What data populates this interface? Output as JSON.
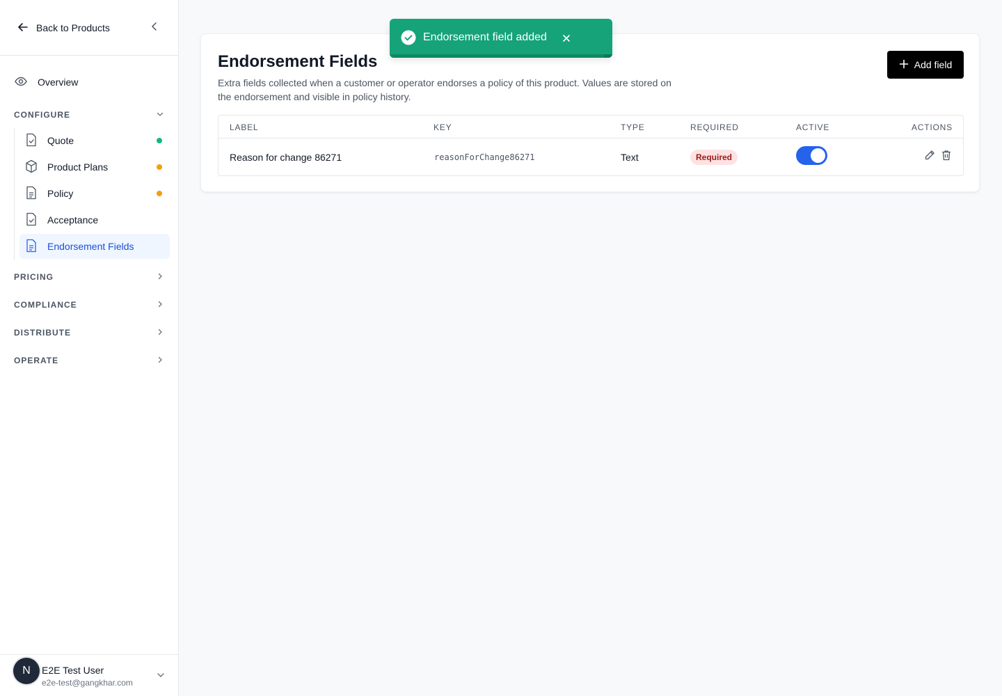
{
  "sidebar": {
    "back_label": "Back to Products",
    "overview_label": "Overview",
    "configure": {
      "heading": "CONFIGURE",
      "items": [
        {
          "label": "Quote",
          "status_color": "#10b981"
        },
        {
          "label": "Product Plans",
          "status_color": "#f59e0b"
        },
        {
          "label": "Policy",
          "status_color": "#f59e0b"
        },
        {
          "label": "Acceptance"
        },
        {
          "label": "Endorsement Fields",
          "active": true
        }
      ]
    },
    "sections": [
      "PRICING",
      "COMPLIANCE",
      "DISTRIBUTE",
      "OPERATE"
    ],
    "user": {
      "initial": "N",
      "name": "E2E Test User",
      "email": "e2e-test@gangkhar.com"
    }
  },
  "main": {
    "title": "Endorsement Fields",
    "description": "Extra fields collected when a customer or operator endorses a policy of this product. Values are stored on the endorsement and visible in policy history.",
    "add_button_label": "Add field",
    "table": {
      "headers": [
        "LABEL",
        "KEY",
        "TYPE",
        "REQUIRED",
        "ACTIVE",
        "ACTIONS"
      ],
      "rows": [
        {
          "label": "Reason for change 86271",
          "key": "reasonForChange86271",
          "type": "Text",
          "required": "Required",
          "active": true
        }
      ]
    }
  },
  "toast": {
    "message": "Endorsement field added",
    "color": "#16a37a"
  },
  "colors": {
    "accent": "#2563eb",
    "active_nav_bg": "#eff6ff",
    "required_badge_bg": "#fee2e2",
    "required_badge_text": "#991b1b"
  }
}
